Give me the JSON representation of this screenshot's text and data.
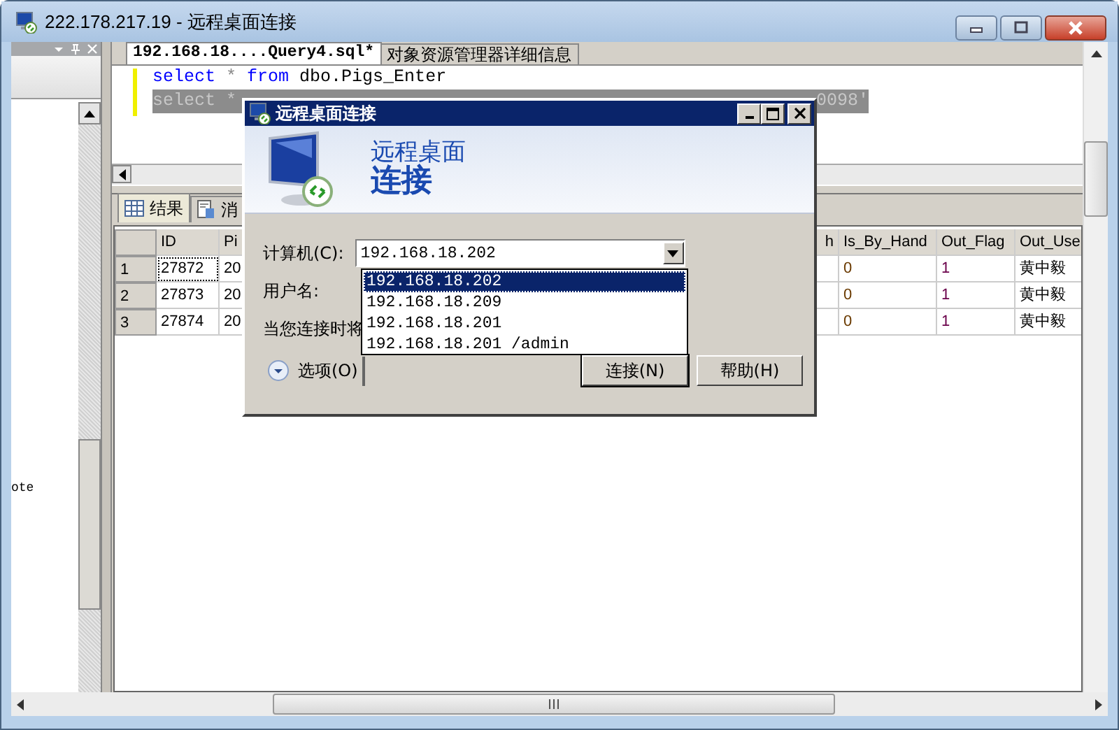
{
  "window": {
    "title": "222.178.217.19 - 远程桌面连接"
  },
  "left_panel": {
    "visible_text": "ote"
  },
  "document_tabs": [
    {
      "label": "192.168.18....Query4.sql*",
      "selected": true
    },
    {
      "label": "对象资源管理器详细信息",
      "selected": false
    }
  ],
  "editor": {
    "lines": [
      {
        "selected": false,
        "parts": [
          {
            "text": "select",
            "kind": "keyword"
          },
          {
            "text": "*",
            "kind": "operator"
          },
          {
            "text": "from",
            "kind": "keyword"
          },
          {
            "text": "dbo.Pigs_Enter",
            "kind": "plain"
          }
        ]
      },
      {
        "selected": true,
        "parts": [
          {
            "text": "select",
            "kind": "keyword"
          },
          {
            "text": "*",
            "kind": "operator"
          }
        ],
        "tail": "0098'"
      }
    ]
  },
  "result_tabs": [
    {
      "label": "结果",
      "kind": "grid",
      "selected": true
    },
    {
      "label": "消",
      "kind": "messages",
      "selected": false
    }
  ],
  "grid": {
    "columns": [
      "ID",
      "Pi",
      "h",
      "Is_By_Hand",
      "Out_Flag",
      "Out_Use"
    ],
    "rows": [
      {
        "number": "1",
        "focused": true,
        "cells": [
          "27872",
          "20",
          null,
          "0",
          "1",
          "黄中毅"
        ]
      },
      {
        "number": "2",
        "focused": false,
        "cells": [
          "27873",
          "20",
          null,
          "0",
          "1",
          "黄中毅"
        ]
      },
      {
        "number": "3",
        "focused": false,
        "cells": [
          "27874",
          "20",
          null,
          "0",
          "1",
          "黄中毅"
        ]
      }
    ]
  },
  "dialog": {
    "title": "远程桌面连接",
    "banner_line1": "远程桌面",
    "banner_line2": "连接",
    "computer_label": "计算机(C):",
    "computer_value": "192.168.18.202",
    "dropdown": [
      {
        "label": "192.168.18.202",
        "selected": true
      },
      {
        "label": "192.168.18.209",
        "selected": false
      },
      {
        "label": "192.168.18.201",
        "selected": false
      },
      {
        "label": "192.168.18.201 /admin",
        "selected": false
      }
    ],
    "username_label": "用户名:",
    "note": "当您连接时将",
    "options_button": "选项(O)",
    "buttons": [
      {
        "label": "连接(N)",
        "default": true
      },
      {
        "label": "帮助(H)",
        "default": false
      }
    ]
  }
}
